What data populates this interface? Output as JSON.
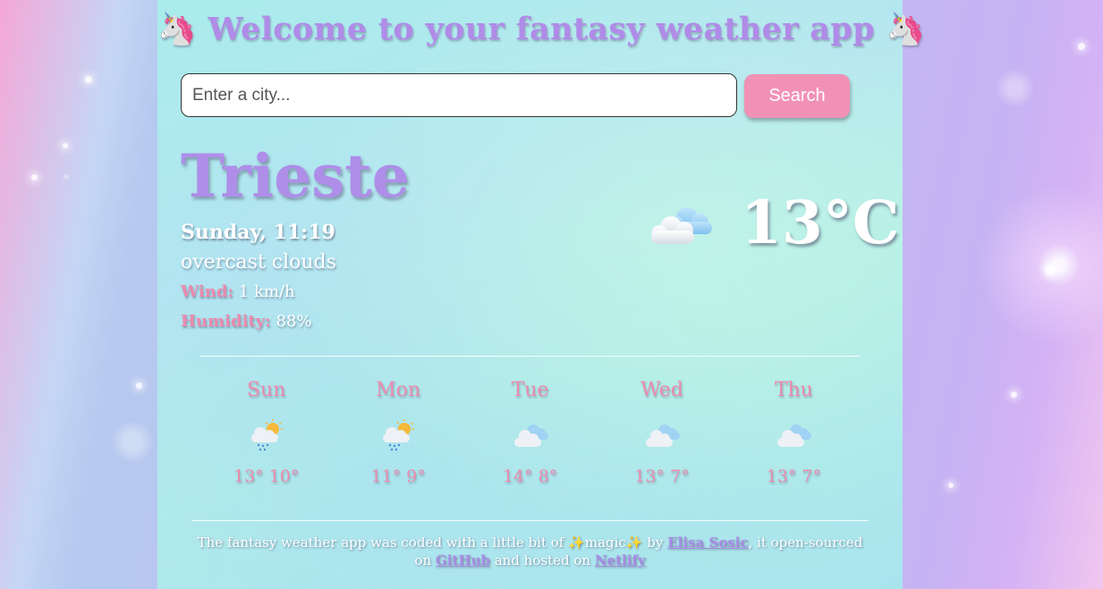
{
  "header": {
    "title": "Welcome to your fantasy weather app",
    "emoji": "🦄"
  },
  "search": {
    "placeholder": "Enter a city...",
    "value": "",
    "button_label": "Search"
  },
  "current": {
    "city": "Trieste",
    "datetime": "Sunday, 11:19",
    "description": "overcast clouds",
    "wind_label": "Wind:",
    "wind_value": "1 km/h",
    "humidity_label": "Humidity:",
    "humidity_value": "88%",
    "temperature": "13°C",
    "icon": "overcast-clouds-icon"
  },
  "forecast": [
    {
      "day": "Sun",
      "icon": "rain-sun-cloud-icon",
      "max": "13°",
      "min": "10°"
    },
    {
      "day": "Mon",
      "icon": "rain-sun-cloud-icon",
      "max": "11°",
      "min": "9°"
    },
    {
      "day": "Tue",
      "icon": "cloud-icon",
      "max": "14°",
      "min": "8°"
    },
    {
      "day": "Wed",
      "icon": "cloud-icon",
      "max": "13°",
      "min": "7°"
    },
    {
      "day": "Thu",
      "icon": "cloud-icon",
      "max": "13°",
      "min": "7°"
    }
  ],
  "footer": {
    "text_before": "The fantasy weather app was coded with a little bit of",
    "sparkle": "✨",
    "magic": "magic",
    "by": "by",
    "author_link": "Elisa Sosic",
    "open_sourced": ", it open-sourced on",
    "github_link": "GitHub",
    "hosted": "and hosted on",
    "netlify_link": "Netlify"
  },
  "colors": {
    "title": "#b08be8",
    "accent_pink": "#ec8aae",
    "button": "#f191b6",
    "link": "#a88be6"
  }
}
